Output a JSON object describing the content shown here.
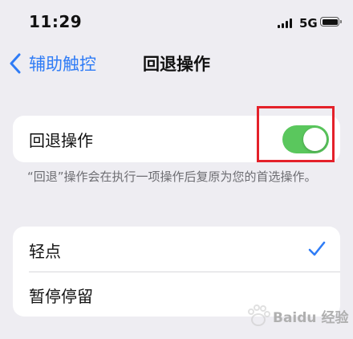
{
  "status_bar": {
    "time": "11:29",
    "network": "5G"
  },
  "nav": {
    "back_label": "辅助触控",
    "title": "回退操作"
  },
  "toggle_row": {
    "label": "回退操作",
    "enabled": true,
    "accent_color": "#5ac75d"
  },
  "footnote": "“回退”操作会在执行一项操作后复原为您的首选操作。",
  "options": [
    {
      "label": "轻点",
      "selected": true
    },
    {
      "label": "暂停停留",
      "selected": false
    }
  ],
  "colors": {
    "accent": "#2f7cf6",
    "highlight": "#e4212a",
    "background": "#eeedf2"
  },
  "watermark": "Baidu 经验"
}
